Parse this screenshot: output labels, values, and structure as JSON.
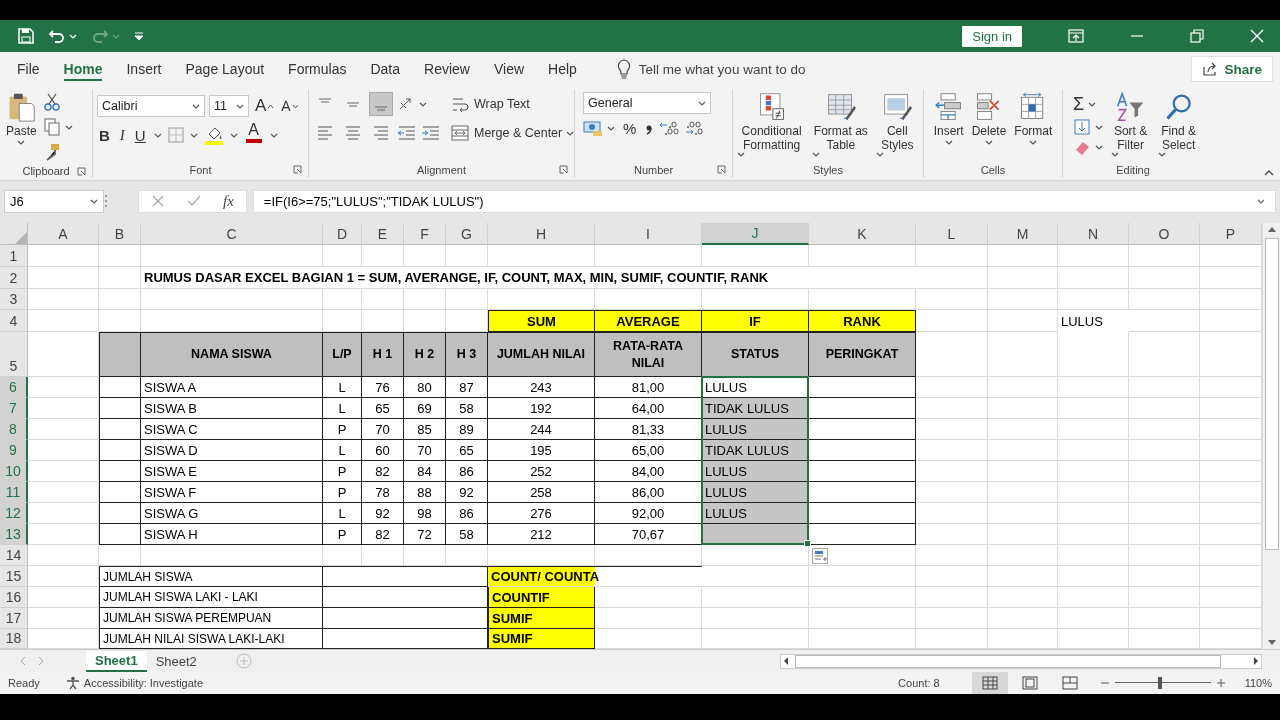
{
  "title_bar": {
    "redo_disabled": true,
    "sign_in": "Sign in"
  },
  "menu_tabs": [
    {
      "label": "File",
      "selected": false
    },
    {
      "label": "Home",
      "selected": true
    },
    {
      "label": "Insert",
      "selected": false
    },
    {
      "label": "Page Layout",
      "selected": false
    },
    {
      "label": "Formulas",
      "selected": false
    },
    {
      "label": "Data",
      "selected": false
    },
    {
      "label": "Review",
      "selected": false
    },
    {
      "label": "View",
      "selected": false
    },
    {
      "label": "Help",
      "selected": false
    }
  ],
  "tell_me": "Tell me what you want to do",
  "share": "Share",
  "ribbon": {
    "clipboard": {
      "label": "Clipboard",
      "paste": "Paste"
    },
    "font": {
      "label": "Font",
      "name": "Calibri",
      "size": "11",
      "grow": "A",
      "shrink": "A",
      "bold": "B",
      "italic": "I",
      "underline": "U",
      "font_color": "A"
    },
    "alignment": {
      "label": "Alignment",
      "vertical_align": [
        {
          "selected": false
        },
        {
          "selected": false
        },
        {
          "selected": true
        }
      ],
      "wrap_text": "Wrap Text",
      "merge_center": "Merge & Center"
    },
    "number": {
      "label": "Number",
      "format": "General",
      "percent": "%"
    },
    "styles": {
      "label": "Styles",
      "buttons": [
        "Conditional Formatting",
        "Format as Table",
        "Cell Styles"
      ]
    },
    "cells": {
      "label": "Cells",
      "buttons": [
        "Insert",
        "Delete",
        "Format"
      ]
    },
    "editing": {
      "label": "Editing",
      "autosum": "Σ",
      "buttons": [
        "Sort & Filter",
        "Find & Select"
      ]
    }
  },
  "formula_bar": {
    "name_box": "J6",
    "fx": "fx",
    "formula": "=IF(I6>=75;\"LULUS\";\"TIDAK LULUS\")"
  },
  "sheet": {
    "columns": [
      {
        "letter": "A",
        "selected": false
      },
      {
        "letter": "B",
        "selected": false
      },
      {
        "letter": "C",
        "selected": false
      },
      {
        "letter": "D",
        "selected": false
      },
      {
        "letter": "E",
        "selected": false
      },
      {
        "letter": "F",
        "selected": false
      },
      {
        "letter": "G",
        "selected": false
      },
      {
        "letter": "H",
        "selected": false
      },
      {
        "letter": "I",
        "selected": false
      },
      {
        "letter": "J",
        "selected": true
      },
      {
        "letter": "K",
        "selected": false
      },
      {
        "letter": "L",
        "selected": false
      },
      {
        "letter": "M",
        "selected": false
      },
      {
        "letter": "N",
        "selected": false
      },
      {
        "letter": "O",
        "selected": false
      },
      {
        "letter": "P",
        "selected": false
      }
    ],
    "rows": [
      {
        "number": "1",
        "selected": false
      },
      {
        "number": "2",
        "selected": false
      },
      {
        "number": "3",
        "selected": false
      },
      {
        "number": "4",
        "selected": false
      },
      {
        "number": "5",
        "selected": false
      },
      {
        "number": "6",
        "selected": true
      },
      {
        "number": "7",
        "selected": true
      },
      {
        "number": "8",
        "selected": true
      },
      {
        "number": "9",
        "selected": true
      },
      {
        "number": "10",
        "selected": true
      },
      {
        "number": "11",
        "selected": true
      },
      {
        "number": "12",
        "selected": true
      },
      {
        "number": "13",
        "selected": true
      },
      {
        "number": "14",
        "selected": false
      },
      {
        "number": "15",
        "selected": false
      },
      {
        "number": "16",
        "selected": false
      },
      {
        "number": "17",
        "selected": false
      },
      {
        "number": "18",
        "selected": false
      }
    ],
    "title": "RUMUS DASAR EXCEL BAGIAN 1 = SUM, AVERANGE, IF, COUNT, MAX, MIN, SUMIF, COUNTIF, RANK",
    "function_labels": [
      "SUM",
      "AVERAGE",
      "IF",
      "RANK"
    ],
    "headers": [
      "NAMA SISWA",
      "L/P",
      "H 1",
      "H 2",
      "H 3",
      "JUMLAH NILAI",
      "RATA-RATA NILAI",
      "STATUS",
      "PERINGKAT"
    ],
    "students": [
      {
        "name": "SISWA A",
        "gender": "L",
        "h1": "76",
        "h2": "80",
        "h3": "87",
        "total": "243",
        "average": "81,00",
        "status": "LULUS",
        "highlighted": false
      },
      {
        "name": "SISWA B",
        "gender": "L",
        "h1": "65",
        "h2": "69",
        "h3": "58",
        "total": "192",
        "average": "64,00",
        "status": "TIDAK LULUS",
        "highlighted": true
      },
      {
        "name": "SISWA C",
        "gender": "P",
        "h1": "70",
        "h2": "85",
        "h3": "89",
        "total": "244",
        "average": "81,33",
        "status": "LULUS",
        "highlighted": true
      },
      {
        "name": "SISWA D",
        "gender": "L",
        "h1": "60",
        "h2": "70",
        "h3": "65",
        "total": "195",
        "average": "65,00",
        "status": "TIDAK LULUS",
        "highlighted": true
      },
      {
        "name": "SISWA E",
        "gender": "P",
        "h1": "82",
        "h2": "84",
        "h3": "86",
        "total": "252",
        "average": "84,00",
        "status": "LULUS",
        "highlighted": true
      },
      {
        "name": "SISWA F",
        "gender": "P",
        "h1": "78",
        "h2": "88",
        "h3": "92",
        "total": "258",
        "average": "86,00",
        "status": "LULUS",
        "highlighted": true
      },
      {
        "name": "SISWA G",
        "gender": "L",
        "h1": "92",
        "h2": "98",
        "h3": "86",
        "total": "276",
        "average": "92,00",
        "status": "LULUS",
        "highlighted": true
      },
      {
        "name": "SISWA H",
        "gender": "P",
        "h1": "82",
        "h2": "72",
        "h3": "58",
        "total": "212",
        "average": "70,67",
        "highlighted": true
      }
    ],
    "note": "LULUS",
    "summary": [
      {
        "label": "JUMLAH SISWA",
        "function": "COUNT/ COUNTA"
      },
      {
        "label": "JUMLAH SISWA LAKI - LAKI",
        "function": "COUNTIF"
      },
      {
        "label": "JUMLAH SISWA PEREMPUAN",
        "function": "SUMIF"
      },
      {
        "label": "JUMLAH NILAI SISWA LAKI-LAKI",
        "function": "SUMIF"
      }
    ]
  },
  "sheet_tabs": [
    {
      "label": "Sheet1",
      "selected": true
    },
    {
      "label": "Sheet2",
      "selected": false
    }
  ],
  "status_bar": {
    "mode": "Ready",
    "accessibility": "Accessibility: Investigate",
    "count": "Count: 8",
    "views": [
      {
        "kind": "normal",
        "selected": true
      },
      {
        "kind": "page_layout",
        "selected": false
      },
      {
        "kind": "page_break",
        "selected": false
      }
    ],
    "zoom_slider": {
      "level": 0.47
    },
    "zoom": "110%"
  }
}
